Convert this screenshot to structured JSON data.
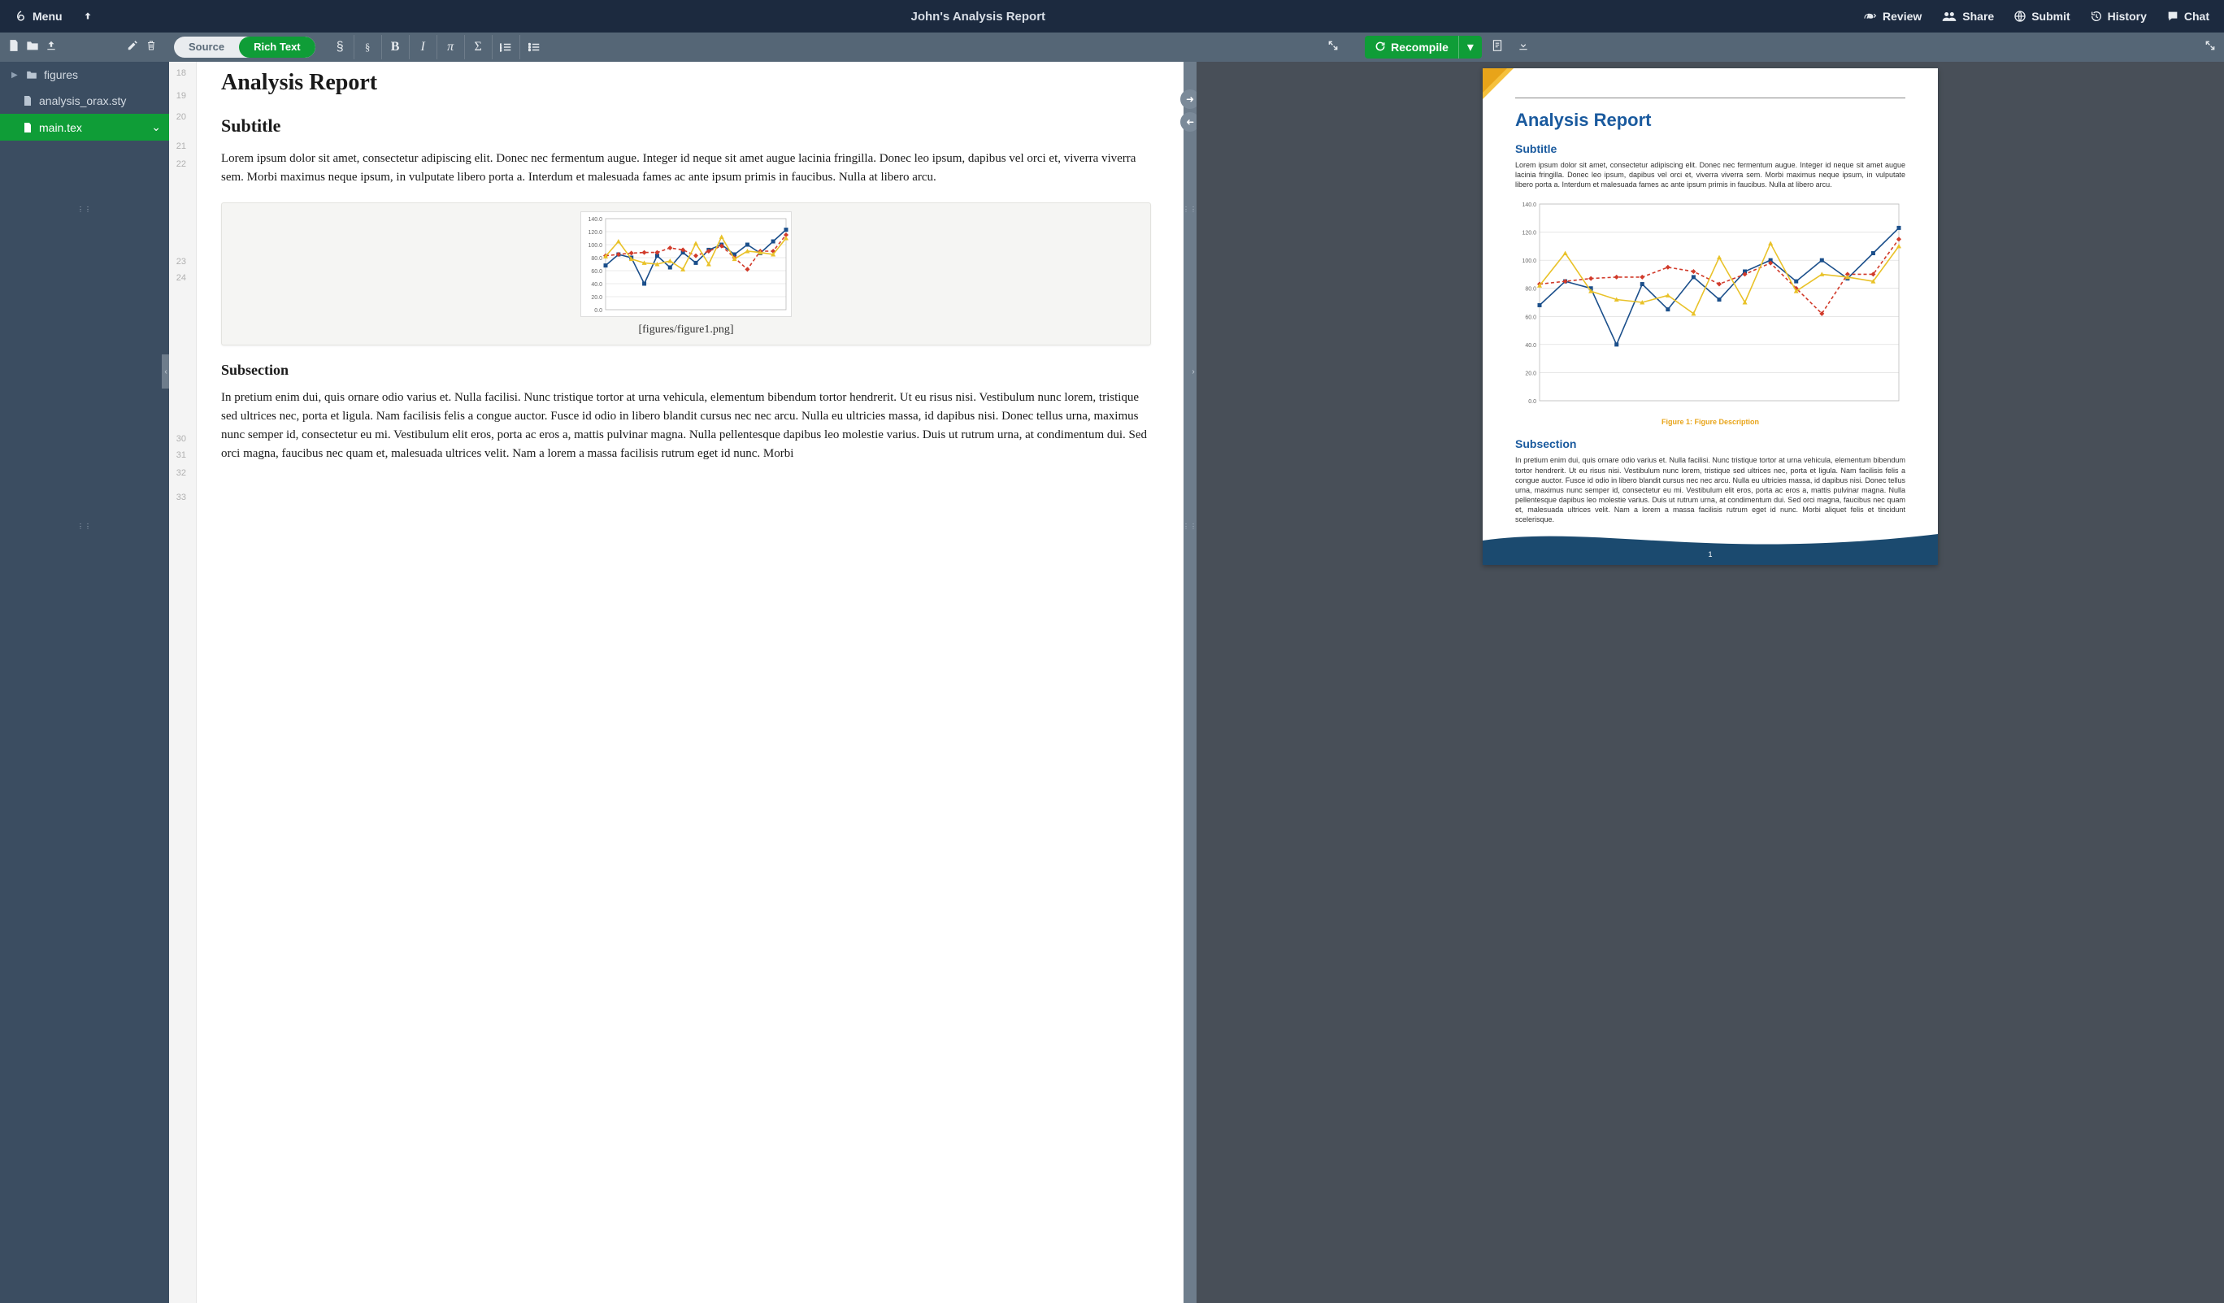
{
  "topbar": {
    "menu": "Menu",
    "title": "John's Analysis Report",
    "review": "Review",
    "share": "Share",
    "submit": "Submit",
    "history": "History",
    "chat": "Chat"
  },
  "toolbar": {
    "mode_source": "Source",
    "mode_rich": "Rich Text",
    "recompile": "Recompile"
  },
  "files": {
    "folder": "figures",
    "sty": "analysis_orax.sty",
    "main": "main.tex"
  },
  "gutter_lines": [
    "18",
    "19",
    "20",
    "21",
    "22",
    "",
    "23",
    "24",
    "",
    "",
    "",
    "",
    "",
    "30",
    "31",
    "32",
    "33"
  ],
  "gutter_offsets": [
    8,
    36,
    62,
    98,
    120,
    0,
    240,
    260,
    0,
    0,
    0,
    0,
    0,
    458,
    478,
    500,
    530
  ],
  "editor": {
    "title": "Analysis Report",
    "subtitle": "Subtitle",
    "para1": "Lorem ipsum dolor sit amet, consectetur adipiscing elit. Donec nec fermentum augue. Integer id neque sit amet augue lacinia fringilla. Donec leo ipsum, dapibus vel orci et, viverra viverra sem. Morbi maximus neque ipsum, in vulputate libero porta a. Interdum et malesuada fames ac ante ipsum primis in faucibus. Nulla at libero arcu.",
    "fig_path": "[figures/figure1.png]",
    "subsection": "Subsection",
    "para2": "In pretium enim dui, quis ornare odio varius et. Nulla facilisi. Nunc tristique tortor at urna vehicula, elementum bibendum tortor hendrerit. Ut eu risus nisi. Vestibulum nunc lorem, tristique sed ultrices nec, porta et ligula. Nam facilisis felis a congue auctor. Fusce id odio in libero blandit cursus nec nec arcu. Nulla eu ultricies massa, id dapibus nisi. Donec tellus urna, maximus nunc semper id, consectetur eu mi. Vestibulum elit eros, porta ac eros a, mattis pulvinar magna. Nulla pellentesque dapibus leo molestie varius. Duis ut rutrum urna, at condimentum dui. Sed orci magna, faucibus nec quam et, malesuada ultrices velit. Nam a lorem a massa facilisis rutrum eget id nunc. Morbi"
  },
  "pdf": {
    "title": "Analysis Report",
    "subtitle": "Subtitle",
    "para1": "Lorem ipsum dolor sit amet, consectetur adipiscing elit. Donec nec fermentum augue. Integer id neque sit amet augue lacinia fringilla. Donec leo ipsum, dapibus vel orci et, viverra viverra sem. Morbi maximus neque ipsum, in vulputate libero porta a. Interdum et malesuada fames ac ante ipsum primis in faucibus. Nulla at libero arcu.",
    "fig_caption": "Figure 1: Figure Description",
    "subsection": "Subsection",
    "para2": "In pretium enim dui, quis ornare odio varius et. Nulla facilisi. Nunc tristique tortor at urna ve­hicula, elementum bibendum tortor hendrerit. Ut eu risus nisi. Vestibulum nunc lorem, tristique sed ultrices nec, porta et ligula. Nam facilisis felis a congue auctor. Fusce id odio in libero blandit cursus nec nec arcu. Nulla eu ultricies massa, id dapibus nisi. Donec tellus urna, maximus nunc semper id, consectetur eu mi. Vestibulum elit eros, porta ac eros a, mattis pulvinar magna. Nulla pellentesque dapibus leo molestie varius. Duis ut rutrum urna, at condimentum dui. Sed orci magna, faucibus nec quam et, malesuada ultrices velit. Nam a lorem a massa facilisis rutrum eget id nunc. Morbi aliquet felis et tincidunt scelerisque.",
    "page_num": "1"
  },
  "chart_data": {
    "type": "line",
    "x": [
      1,
      2,
      3,
      4,
      5,
      6,
      7,
      8,
      9,
      10,
      11,
      12,
      13,
      14,
      15
    ],
    "series": [
      {
        "name": "blue",
        "color": "#1b4f8b",
        "style": "solid",
        "marker": "square",
        "values": [
          68,
          85,
          80,
          40,
          83,
          65,
          88,
          72,
          92,
          100,
          85,
          100,
          87,
          105,
          123
        ]
      },
      {
        "name": "red",
        "color": "#d13a2a",
        "style": "dashed",
        "marker": "diamond",
        "values": [
          83,
          85,
          87,
          88,
          88,
          95,
          92,
          83,
          90,
          98,
          80,
          62,
          90,
          90,
          115
        ]
      },
      {
        "name": "yellow",
        "color": "#e9c229",
        "style": "solid",
        "marker": "triangle",
        "values": [
          82,
          105,
          78,
          72,
          70,
          75,
          62,
          102,
          70,
          112,
          78,
          90,
          88,
          85,
          110
        ]
      }
    ],
    "y_ticks": [
      0,
      20,
      40,
      60,
      80,
      100,
      120,
      140
    ],
    "y_tick_labels": [
      "0.0",
      "20.0",
      "40.0",
      "60.0",
      "80.0",
      "100.0",
      "120.0",
      "140.0"
    ],
    "ylim": [
      0,
      140
    ]
  }
}
